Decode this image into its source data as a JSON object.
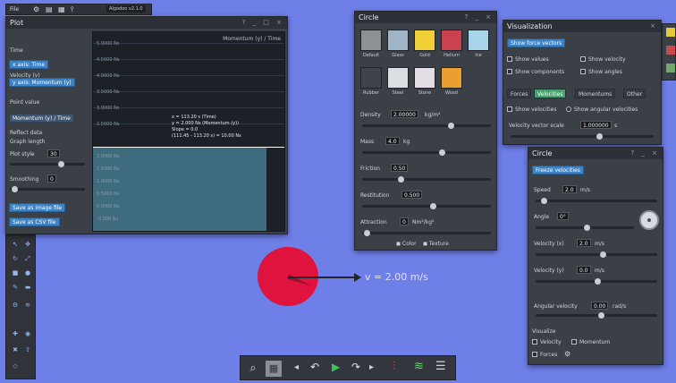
{
  "menubar": {
    "file": "File",
    "items": [
      "⚙",
      "▤",
      "▦",
      "🌡"
    ],
    "field": "Algodoo v2.1.0"
  },
  "graph_panel": {
    "title": "Plot",
    "labels": [
      "Time",
      "Velocity (v)",
      "Point value",
      "Reflect data",
      "Graph length",
      "Plot style",
      "Smoothing"
    ],
    "btn_x": "x axis: Time",
    "btn_y": "y axis: Momentum (y)",
    "btn_export": "Save as image file",
    "btn_csv": "Save as CSV file",
    "plotlength_val": "30",
    "smoothing_val": "0",
    "top_legend": "Momentum (y) / Time",
    "y_ticks": [
      "5.0000 Ns",
      "4.5000 Ns",
      "4.0000 Ns",
      "3.5000 Ns",
      "3.0000 Ns",
      "2.5000 Ns",
      "2.0000 Ns",
      "1.5000 Ns",
      "1.0000 Ns",
      "0.5000 Ns",
      "0.0000 Ns",
      "-0.500 Ns"
    ],
    "tooltip": [
      "x = 113.20 s (Time)",
      "y = 2.000 Ns (Momentum (y))",
      "Slope = 0.0",
      "(111.45 - 113.20 s) = 10.00 Ns"
    ]
  },
  "material_panel": {
    "title": "Circle",
    "swatches": [
      {
        "label": "Default",
        "color": "#8e9096"
      },
      {
        "label": "Glass",
        "color": "#9fb4c7"
      },
      {
        "label": "Gold",
        "color": "#f2d03a"
      },
      {
        "label": "Helium",
        "color": "#c8424f"
      },
      {
        "label": "Ice",
        "color": "#a9d5ea"
      },
      {
        "label": "Rubber",
        "color": "#3f4248"
      },
      {
        "label": "Steel",
        "color": "#dcdde2"
      },
      {
        "label": "Stone",
        "color": "#e4dde4"
      },
      {
        "label": "Wood",
        "color": "#eb9f33"
      }
    ],
    "density_label": "Density",
    "density_val": "2.00000",
    "density_unit": "kg/m²",
    "mass_label": "Mass",
    "mass_val": "4.0",
    "mass_unit": "kg",
    "friction_label": "Friction",
    "friction_val": "0.50",
    "restitution_label": "Restitution",
    "restitution_val": "0.500",
    "attraction_label": "Attraction",
    "attraction_val": "0",
    "attraction_unit": "Nm²/kg²",
    "footer": [
      "Color",
      "Texture"
    ]
  },
  "visualization_panel": {
    "title": "Visualization",
    "show_forces_btn": "Show force vectors",
    "opts": [
      "Show values",
      "Show velocity",
      "Show components",
      "Show angles"
    ],
    "tabs": [
      "Forces",
      "Velocities",
      "Momentums",
      "Other"
    ],
    "velocity_opts": [
      "Show velocities",
      "Show angular velocities"
    ],
    "scale_label": "Velocity vector scale",
    "scale_val": "1.000000",
    "scale_unit": "s"
  },
  "velocity_panel": {
    "title": "Circle",
    "freeze_btn": "Freeze velocities",
    "speed_label": "Speed",
    "speed_val": "2.0",
    "speed_unit": "m/s",
    "angle_label": "Angle",
    "angle_val": "0°",
    "velx_label": "Velocity (x)",
    "velx_val": "2.0",
    "velx_unit": "m/s",
    "vely_label": "Velocity (y)",
    "vely_val": "0.0",
    "vely_unit": "m/s",
    "angvel_label": "Angular velocity",
    "angvel_val": "0.00",
    "angvel_unit": "rad/s",
    "vis_label": "Visualize",
    "vis_opts": [
      "Velocity",
      "Momentum",
      "Forces"
    ]
  },
  "canvas": {
    "velocity_text": "v = 2.00 m/s",
    "ball_color": "#e0133e"
  },
  "bottom_toolbar": {
    "buttons": [
      "zoom-icon",
      "grid-icon",
      "undo-icon",
      "redo-icon",
      "play-icon",
      "forward-icon",
      "chart-icon",
      "graph-icon",
      "list-icon"
    ]
  },
  "colors": {
    "canvas_bg": "#6f7fe8",
    "panel_bg": "#3b3f46",
    "accent_blue": "#3d82c4",
    "accent_green": "#4aa070"
  }
}
